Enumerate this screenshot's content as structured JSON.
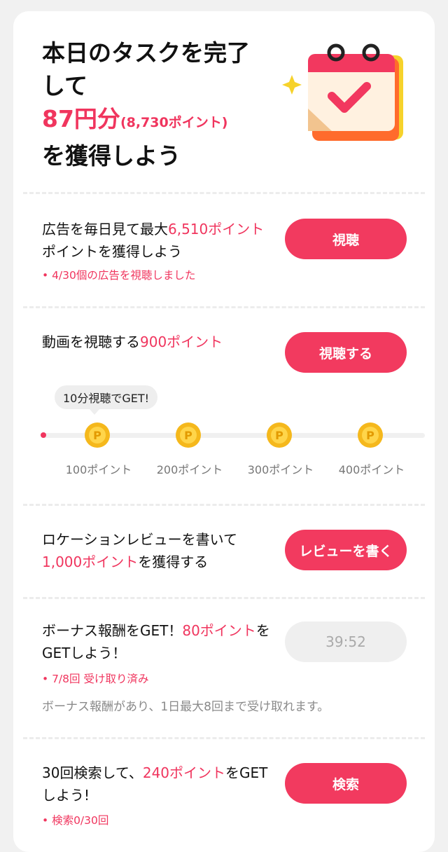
{
  "hero": {
    "title_line1": "本日のタスクを完了して",
    "amount": "87円分",
    "amount_points": "(8,730ポイント)",
    "title_line3": "を獲得しよう"
  },
  "tasks": [
    {
      "title_pre": "広告を毎日見て最大",
      "title_points": "6,510ポイント",
      "title_post": "ポイントを獲得しよう",
      "status": "• 4/30個の広告を視聴しました",
      "button": "視聴"
    },
    {
      "title_pre": "動画を視聴する",
      "title_points": "900ポイント",
      "button": "視聴する",
      "tooltip": "10分視聴でGET!",
      "milestones": [
        "100ポイント",
        "200ポイント",
        "300ポイント",
        "400ポイント"
      ],
      "progress": 0
    },
    {
      "title_pre": "ロケーションレビューを書いて",
      "title_points": "1,000ポイント",
      "title_post": "を獲得する",
      "button": "レビューを書く"
    },
    {
      "title_pre": "ボーナス報酬をGET！",
      "title_points": "80ポイント",
      "title_post": "をGETしよう！",
      "status": "• 7/8回 受け取り済み",
      "note": "ボーナス報酬があり、1日最大8回まで受け取れます。",
      "button": "39:52"
    },
    {
      "title_pre": "30回検索して、",
      "title_points": "240ポイント",
      "title_post": "をGETしよう!",
      "status": "• 検索0/30回",
      "button": "検索"
    }
  ],
  "colors": {
    "accent": "#f0355e",
    "button": "#f23a5f",
    "coin": "#f5b81c"
  },
  "icons": {
    "hero": "calendar-check-icon",
    "coin": "p-coin-icon"
  }
}
